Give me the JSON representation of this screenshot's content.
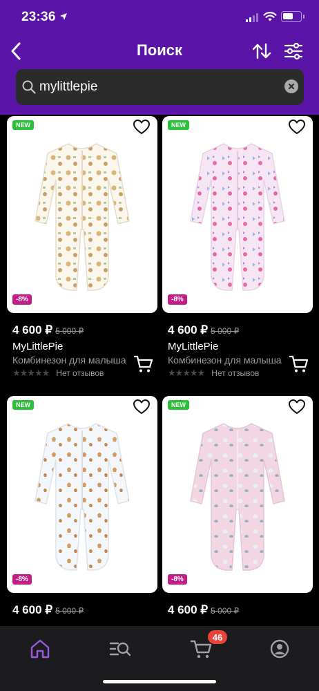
{
  "status_bar": {
    "time": "23:36"
  },
  "header": {
    "title": "Поиск"
  },
  "search": {
    "value": "mylittlepie"
  },
  "colors": {
    "header_bg": "#5b14a8",
    "new_badge": "#2dc03b",
    "discount_badge": "#c21f86",
    "cart_badge": "#e8443a",
    "active_tab": "#9b59e0"
  },
  "products": [
    {
      "new_badge": "NEW",
      "discount": "-8%",
      "price": "4 600 ₽",
      "old_price": "5 000 ₽",
      "brand": "MyLittlePie",
      "name": "Комбинезон для малыша",
      "reviews": "Нет отзывов",
      "print": "teddy-bears"
    },
    {
      "new_badge": "NEW",
      "discount": "-8%",
      "price": "4 600 ₽",
      "old_price": "5 000 ₽",
      "brand": "MyLittlePie",
      "name": "Комбинезон для малыша",
      "reviews": "Нет отзывов",
      "print": "butterflies"
    },
    {
      "new_badge": "NEW",
      "discount": "-8%",
      "price": "4 600 ₽",
      "old_price": "5 000 ₽",
      "print": "deer"
    },
    {
      "new_badge": "NEW",
      "discount": "-8%",
      "price": "4 600 ₽",
      "old_price": "5 000 ₽",
      "print": "unicorns"
    }
  ],
  "tabbar": {
    "items": [
      "home-icon",
      "catalog-search-icon",
      "cart-icon",
      "profile-icon"
    ],
    "cart_count": "46"
  }
}
